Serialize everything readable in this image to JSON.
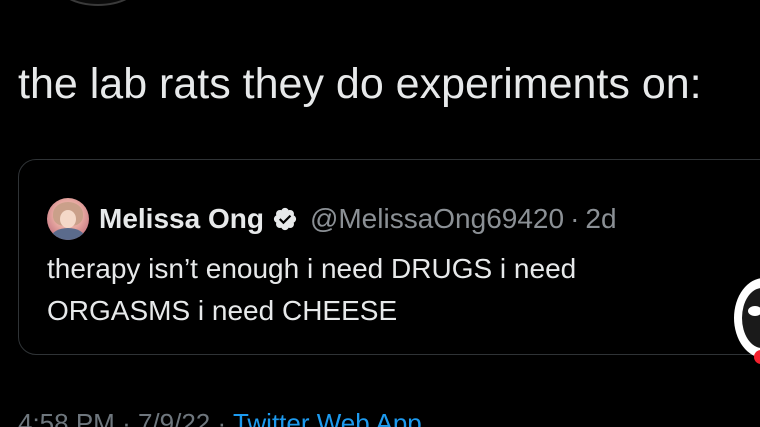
{
  "tweet": {
    "text": "the lab rats they do experiments on:"
  },
  "quoted_tweet": {
    "display_name": "Melissa Ong",
    "handle": "@MelissaOng69420",
    "separator": "·",
    "relative_time": "2d",
    "body_line_1": "therapy isn’t enough i need DRUGS i need",
    "body_line_2": "ORGASMS i need CHEESE"
  },
  "footer": {
    "time": "4:58 PM",
    "dot": "·",
    "date": "7/9/22",
    "source": "Twitter Web App"
  },
  "colors": {
    "background": "#000000",
    "primary_text": "#e7e9ea",
    "secondary_text": "#8b9095",
    "card_border": "#2f3336",
    "link_blue": "#1d9bf0",
    "notification_red": "#f4212e"
  },
  "icons": {
    "verified": "verified-badge-icon"
  }
}
